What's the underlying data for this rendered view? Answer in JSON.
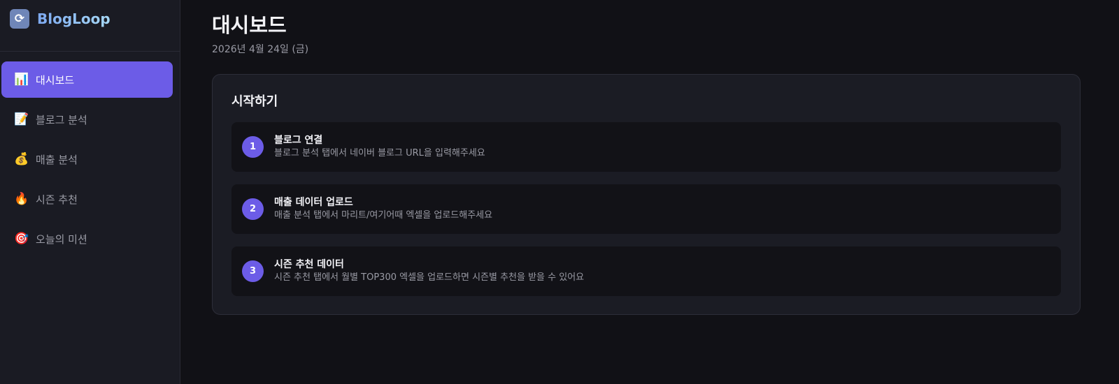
{
  "brand": {
    "icon": "repeat-icon",
    "name": "BlogLoop"
  },
  "sidebar": {
    "items": [
      {
        "icon": "chart-icon",
        "glyph": "📊",
        "label": "대시보드",
        "active": true
      },
      {
        "icon": "memo-icon",
        "glyph": "📝",
        "label": "블로그 분석",
        "active": false
      },
      {
        "icon": "money-bag-icon",
        "glyph": "💰",
        "label": "매출 분석",
        "active": false
      },
      {
        "icon": "fire-icon",
        "glyph": "🔥",
        "label": "시즌 추천",
        "active": false
      },
      {
        "icon": "target-icon",
        "glyph": "🎯",
        "label": "오늘의 미션",
        "active": false
      }
    ]
  },
  "main": {
    "title": "대시보드",
    "date": "2026년 4월 24일 (금)",
    "getting_started": {
      "title": "시작하기",
      "steps": [
        {
          "number": "1",
          "title": "블로그 연결",
          "description": "블로그 분석 탭에서 네이버 블로그 URL을 입력해주세요"
        },
        {
          "number": "2",
          "title": "매출 데이터 업로드",
          "description": "매출 분석 탭에서 마리트/여기어때 엑셀을 업로드해주세요"
        },
        {
          "number": "3",
          "title": "시즌 추천 데이터",
          "description": "시즌 추천 탭에서 월별 TOP300 엑셀을 업로드하면 시즌별 추천을 받을 수 있어요"
        }
      ]
    }
  },
  "colors": {
    "accent": "#6c5ce7",
    "sidebar_bg": "#1a1b23",
    "page_bg": "#111116",
    "card_bg": "#1b1c24",
    "step_bg": "#121217"
  }
}
